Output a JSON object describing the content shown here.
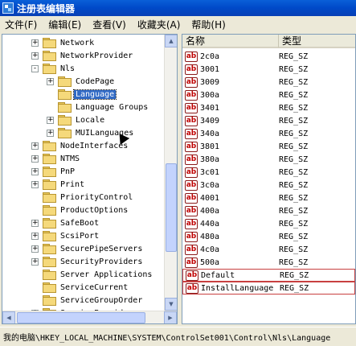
{
  "window": {
    "title": "注册表编辑器",
    "app_icon": "regedit-icon"
  },
  "menu": [
    "文件(F)",
    "编辑(E)",
    "查看(V)",
    "收藏夹(A)",
    "帮助(H)"
  ],
  "tree": [
    {
      "label": "Network",
      "expander": "+",
      "selected": false
    },
    {
      "label": "NetworkProvider",
      "expander": "+",
      "selected": false
    },
    {
      "label": "Nls",
      "expander": "-",
      "selected": false
    },
    {
      "label": "CodePage",
      "expander": "+",
      "selected": false
    },
    {
      "label": "Language",
      "expander": "",
      "selected": true
    },
    {
      "label": "Language Groups",
      "expander": "",
      "selected": false
    },
    {
      "label": "Locale",
      "expander": "+",
      "selected": false
    },
    {
      "label": "MUILanguages",
      "expander": "+",
      "selected": false
    },
    {
      "label": "NodeInterfaces",
      "expander": "+",
      "selected": false
    },
    {
      "label": "NTMS",
      "expander": "+",
      "selected": false
    },
    {
      "label": "PnP",
      "expander": "+",
      "selected": false
    },
    {
      "label": "Print",
      "expander": "+",
      "selected": false
    },
    {
      "label": "PriorityControl",
      "expander": "",
      "selected": false
    },
    {
      "label": "ProductOptions",
      "expander": "",
      "selected": false
    },
    {
      "label": "SafeBoot",
      "expander": "+",
      "selected": false
    },
    {
      "label": "ScsiPort",
      "expander": "+",
      "selected": false
    },
    {
      "label": "SecurePipeServers",
      "expander": "+",
      "selected": false
    },
    {
      "label": "SecurityProviders",
      "expander": "+",
      "selected": false
    },
    {
      "label": "Server Applications",
      "expander": "",
      "selected": false
    },
    {
      "label": "ServiceCurrent",
      "expander": "",
      "selected": false
    },
    {
      "label": "ServiceGroupOrder",
      "expander": "",
      "selected": false
    },
    {
      "label": "ServiceProvider",
      "expander": "+",
      "selected": false
    }
  ],
  "list_headers": {
    "name": "名称",
    "type": "类型"
  },
  "values": [
    {
      "name": "2c0a",
      "type": "REG_SZ",
      "highlighted": false
    },
    {
      "name": "3001",
      "type": "REG_SZ",
      "highlighted": false
    },
    {
      "name": "3009",
      "type": "REG_SZ",
      "highlighted": false
    },
    {
      "name": "300a",
      "type": "REG_SZ",
      "highlighted": false
    },
    {
      "name": "3401",
      "type": "REG_SZ",
      "highlighted": false
    },
    {
      "name": "3409",
      "type": "REG_SZ",
      "highlighted": false
    },
    {
      "name": "340a",
      "type": "REG_SZ",
      "highlighted": false
    },
    {
      "name": "3801",
      "type": "REG_SZ",
      "highlighted": false
    },
    {
      "name": "380a",
      "type": "REG_SZ",
      "highlighted": false
    },
    {
      "name": "3c01",
      "type": "REG_SZ",
      "highlighted": false
    },
    {
      "name": "3c0a",
      "type": "REG_SZ",
      "highlighted": false
    },
    {
      "name": "4001",
      "type": "REG_SZ",
      "highlighted": false
    },
    {
      "name": "400a",
      "type": "REG_SZ",
      "highlighted": false
    },
    {
      "name": "440a",
      "type": "REG_SZ",
      "highlighted": false
    },
    {
      "name": "480a",
      "type": "REG_SZ",
      "highlighted": false
    },
    {
      "name": "4c0a",
      "type": "REG_SZ",
      "highlighted": false
    },
    {
      "name": "500a",
      "type": "REG_SZ",
      "highlighted": false
    },
    {
      "name": "Default",
      "type": "REG_SZ",
      "highlighted": true
    },
    {
      "name": "InstallLanguage",
      "type": "REG_SZ",
      "highlighted": true
    }
  ],
  "value_icon_text": "ab",
  "status_path": "我的电脑\\HKEY_LOCAL_MACHINE\\SYSTEM\\ControlSet001\\Control\\Nls\\Language"
}
